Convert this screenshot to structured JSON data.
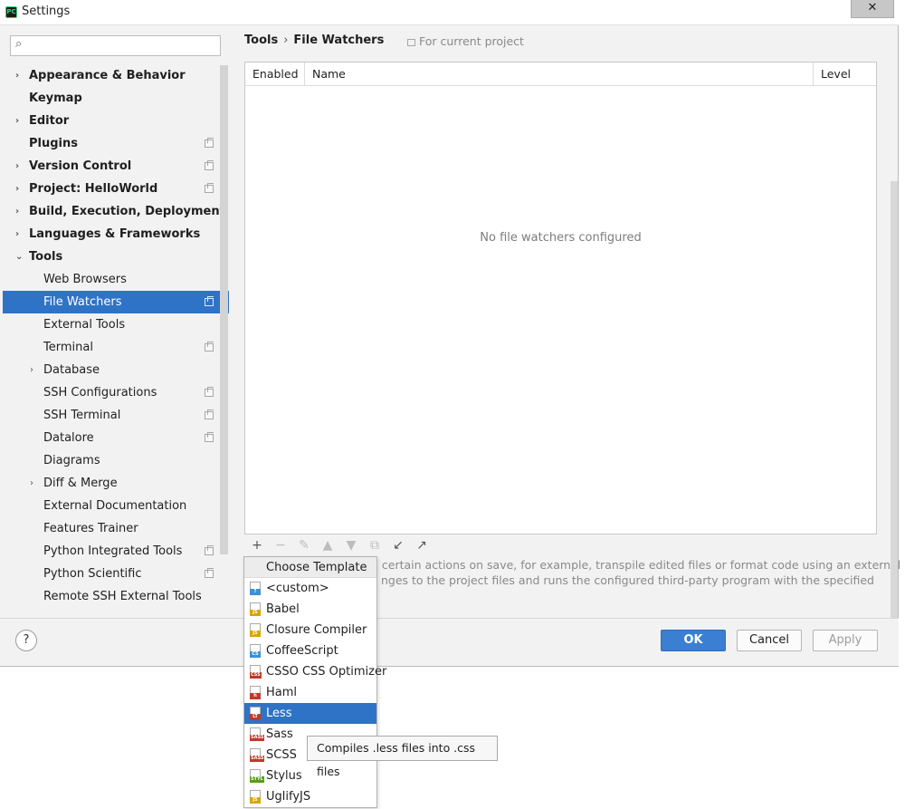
{
  "window": {
    "title": "Settings",
    "close_glyph": "✕",
    "app_icon_text": "PC"
  },
  "search": {
    "placeholder": "",
    "value": "",
    "icon": "search-icon"
  },
  "sidebar": {
    "items": [
      {
        "label": "Appearance & Behavior",
        "bold": true,
        "arrow": "›",
        "level": 0,
        "project": false,
        "selected": false
      },
      {
        "label": "Keymap",
        "bold": true,
        "arrow": "",
        "level": 0,
        "project": false,
        "selected": false
      },
      {
        "label": "Editor",
        "bold": true,
        "arrow": "›",
        "level": 0,
        "project": false,
        "selected": false
      },
      {
        "label": "Plugins",
        "bold": true,
        "arrow": "",
        "level": 0,
        "project": true,
        "selected": false
      },
      {
        "label": "Version Control",
        "bold": true,
        "arrow": "›",
        "level": 0,
        "project": true,
        "selected": false
      },
      {
        "label": "Project: HelloWorld",
        "bold": true,
        "arrow": "›",
        "level": 0,
        "project": true,
        "selected": false
      },
      {
        "label": "Build, Execution, Deployment",
        "bold": true,
        "arrow": "›",
        "level": 0,
        "project": false,
        "selected": false
      },
      {
        "label": "Languages & Frameworks",
        "bold": true,
        "arrow": "›",
        "level": 0,
        "project": false,
        "selected": false
      },
      {
        "label": "Tools",
        "bold": true,
        "arrow": "⌄",
        "level": 0,
        "project": false,
        "selected": false
      },
      {
        "label": "Web Browsers",
        "bold": false,
        "arrow": "",
        "level": 1,
        "project": false,
        "selected": false
      },
      {
        "label": "File Watchers",
        "bold": false,
        "arrow": "",
        "level": 1,
        "project": true,
        "selected": true
      },
      {
        "label": "External Tools",
        "bold": false,
        "arrow": "",
        "level": 1,
        "project": false,
        "selected": false
      },
      {
        "label": "Terminal",
        "bold": false,
        "arrow": "",
        "level": 1,
        "project": true,
        "selected": false
      },
      {
        "label": "Database",
        "bold": false,
        "arrow": "›",
        "level": 1,
        "project": false,
        "selected": false
      },
      {
        "label": "SSH Configurations",
        "bold": false,
        "arrow": "",
        "level": 1,
        "project": true,
        "selected": false
      },
      {
        "label": "SSH Terminal",
        "bold": false,
        "arrow": "",
        "level": 1,
        "project": true,
        "selected": false
      },
      {
        "label": "Datalore",
        "bold": false,
        "arrow": "",
        "level": 1,
        "project": true,
        "selected": false
      },
      {
        "label": "Diagrams",
        "bold": false,
        "arrow": "",
        "level": 1,
        "project": false,
        "selected": false
      },
      {
        "label": "Diff & Merge",
        "bold": false,
        "arrow": "›",
        "level": 1,
        "project": false,
        "selected": false
      },
      {
        "label": "External Documentation",
        "bold": false,
        "arrow": "",
        "level": 1,
        "project": false,
        "selected": false
      },
      {
        "label": "Features Trainer",
        "bold": false,
        "arrow": "",
        "level": 1,
        "project": false,
        "selected": false
      },
      {
        "label": "Python Integrated Tools",
        "bold": false,
        "arrow": "",
        "level": 1,
        "project": true,
        "selected": false
      },
      {
        "label": "Python Scientific",
        "bold": false,
        "arrow": "",
        "level": 1,
        "project": true,
        "selected": false
      },
      {
        "label": "Remote SSH External Tools",
        "bold": false,
        "arrow": "",
        "level": 1,
        "project": false,
        "selected": false
      }
    ]
  },
  "content": {
    "breadcrumb": {
      "parent": "Tools",
      "separator": "›",
      "current": "File Watchers"
    },
    "scope_label": "For current project",
    "table": {
      "columns": {
        "enabled": "Enabled",
        "name": "Name",
        "level": "Level"
      },
      "empty_text": "No file watchers configured"
    },
    "toolbar": [
      {
        "name": "add-icon",
        "glyph": "+",
        "enabled": true
      },
      {
        "name": "remove-icon",
        "glyph": "−",
        "enabled": false
      },
      {
        "name": "edit-icon",
        "glyph": "✎",
        "enabled": false
      },
      {
        "name": "move-up-icon",
        "glyph": "▲",
        "enabled": false
      },
      {
        "name": "move-down-icon",
        "glyph": "▼",
        "enabled": false
      },
      {
        "name": "copy-icon",
        "glyph": "⧉",
        "enabled": false
      },
      {
        "name": "import-icon",
        "glyph": "↙",
        "enabled": true
      },
      {
        "name": "export-icon",
        "glyph": "↗",
        "enabled": true
      }
    ],
    "description_line1": "n certain actions on save, for example, transpile edited files or format code using an external",
    "description_line2": "nges to the project files and runs the configured third-party program with the specified"
  },
  "footer": {
    "help": "?",
    "ok": "OK",
    "cancel": "Cancel",
    "apply": "Apply"
  },
  "popup": {
    "header": "Choose Template",
    "items": [
      {
        "label": "<custom>",
        "tag": "?",
        "tag_color": "#3d8fd8",
        "icon": "custom-file-icon",
        "selected": false
      },
      {
        "label": "Babel",
        "tag": "JS",
        "tag_color": "#d9a400",
        "icon": "js-file-icon",
        "selected": false
      },
      {
        "label": "Closure Compiler",
        "tag": "JS",
        "tag_color": "#d9a400",
        "icon": "js-file-icon",
        "selected": false
      },
      {
        "label": "CoffeeScript",
        "tag": "CS",
        "tag_color": "#3d8fd8",
        "icon": "coffeescript-file-icon",
        "selected": false
      },
      {
        "label": "CSSO CSS Optimizer",
        "tag": "CSS",
        "tag_color": "#c0392b",
        "icon": "css-file-icon",
        "selected": false
      },
      {
        "label": "Haml",
        "tag": "h",
        "tag_color": "#c0392b",
        "icon": "haml-file-icon",
        "selected": false
      },
      {
        "label": "Less",
        "tag": "LT",
        "tag_color": "#c0392b",
        "icon": "less-file-icon",
        "selected": true
      },
      {
        "label": "Sass",
        "tag": "SASS",
        "tag_color": "#c0392b",
        "icon": "sass-file-icon",
        "selected": false
      },
      {
        "label": "SCSS",
        "tag": "SASS",
        "tag_color": "#c0392b",
        "icon": "scss-file-icon",
        "selected": false
      },
      {
        "label": "Stylus",
        "tag": "STYL",
        "tag_color": "#5a9a1c",
        "icon": "stylus-file-icon",
        "selected": false
      },
      {
        "label": "UglifyJS",
        "tag": "JS",
        "tag_color": "#d9a400",
        "icon": "js-file-icon",
        "selected": false
      }
    ]
  },
  "tooltip": {
    "text": "Compiles .less files into .css files"
  },
  "colors": {
    "accent": "#2f73c6",
    "ok_button": "#3a7fd1",
    "muted_text": "#8a8a8a"
  }
}
